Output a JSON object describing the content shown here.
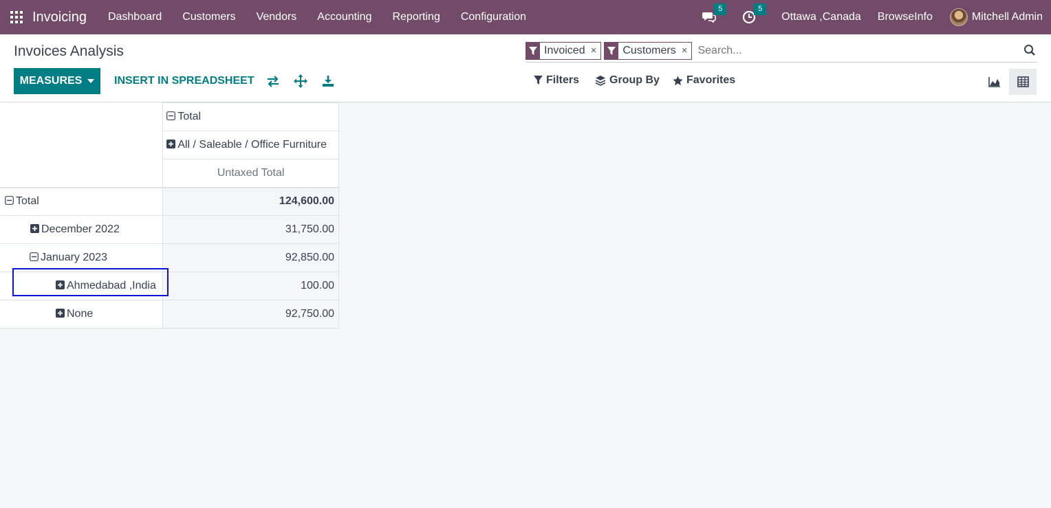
{
  "navbar": {
    "app_name": "Invoicing",
    "menu": [
      "Dashboard",
      "Customers",
      "Vendors",
      "Accounting",
      "Reporting",
      "Configuration"
    ],
    "messages_count": "5",
    "activities_count": "5",
    "company": "Ottawa ,Canada",
    "company2": "BrowseInfo",
    "user": "Mitchell Admin"
  },
  "control": {
    "title": "Invoices Analysis",
    "measures_label": "MEASURES",
    "insert_label": "INSERT IN SPREADSHEET",
    "facets": [
      "Invoiced",
      "Customers"
    ],
    "search_placeholder": "Search...",
    "filters_label": "Filters",
    "groupby_label": "Group By",
    "favorites_label": "Favorites"
  },
  "pivot": {
    "col_total": "Total",
    "col_group": "All / Saleable / Office Furniture",
    "measure": "Untaxed Total",
    "rows": [
      {
        "label": "Total",
        "value": "124,600.00"
      },
      {
        "label": "December 2022",
        "value": "31,750.00"
      },
      {
        "label": "January 2023",
        "value": "92,850.00"
      },
      {
        "label": "Ahmedabad ,India",
        "value": "100.00"
      },
      {
        "label": "None",
        "value": "92,750.00"
      }
    ]
  },
  "colors": {
    "brand": "#714b67",
    "accent": "#017e84",
    "highlight": "#0a13d8"
  }
}
